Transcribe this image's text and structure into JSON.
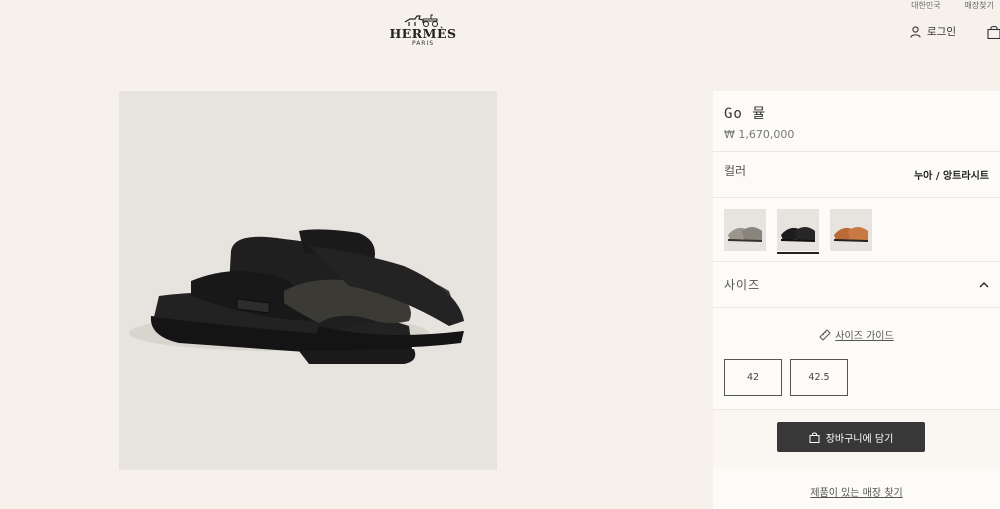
{
  "header": {
    "top_links": [
      "대한민국",
      "매장찾기"
    ],
    "logo": {
      "wordmark": "HERMÈS",
      "sub": "PARIS"
    },
    "login_label": "로그인",
    "icons": [
      "user-icon",
      "shopping-bag-icon"
    ]
  },
  "product": {
    "name": "Go 뮬",
    "price": "₩ 1,670,000",
    "color_label": "컬러",
    "color_value": "누아 / 앙트라시트",
    "swatches": [
      {
        "name": "grey",
        "color": "#9a958d",
        "selected": false
      },
      {
        "name": "black",
        "color": "#1c1c1c",
        "selected": true
      },
      {
        "name": "tan",
        "color": "#b96a35",
        "selected": false
      }
    ],
    "size_label": "사이즈",
    "size_guide": "사이즈 가이드",
    "sizes": [
      "42",
      "42.5"
    ],
    "add_to_cart": "장바구니에 담기",
    "find_store": "제품이 있는 매장 찾기"
  },
  "colors": {
    "background": "#f6f1eb",
    "panel": "#fdfbf8",
    "button": "#383838"
  }
}
